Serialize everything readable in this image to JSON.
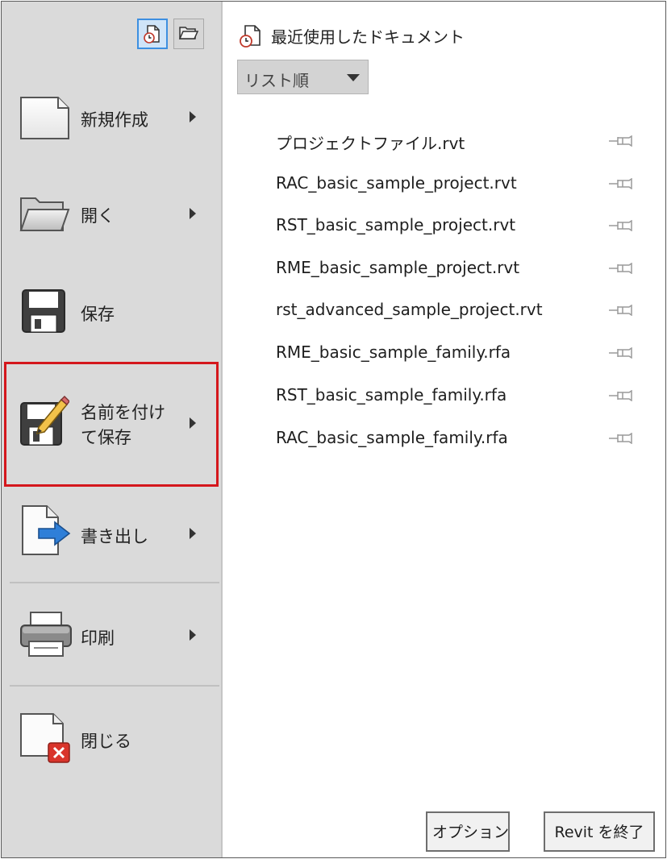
{
  "left_menu": {
    "items": [
      {
        "label": "新規作成",
        "icon": "new-document-icon",
        "has_submenu": true
      },
      {
        "label": "開く",
        "icon": "open-folder-icon",
        "has_submenu": true
      },
      {
        "label": "保存",
        "icon": "save-disk-icon",
        "has_submenu": false
      },
      {
        "label_line1": "名前を付け",
        "label_line2": "て保存",
        "icon": "save-as-icon",
        "has_submenu": true,
        "highlighted": true
      },
      {
        "label": "書き出し",
        "icon": "export-icon",
        "has_submenu": true
      },
      {
        "label": "印刷",
        "icon": "printer-icon",
        "has_submenu": true
      },
      {
        "label": "閉じる",
        "icon": "close-document-icon",
        "has_submenu": false
      }
    ],
    "view_toggles": [
      "recent-documents-icon",
      "open-documents-icon"
    ]
  },
  "recent": {
    "title": "最近使用したドキュメント",
    "sort_value": "リスト順",
    "documents": [
      "プロジェクトファイル.rvt",
      "RAC_basic_sample_project.rvt",
      "RST_basic_sample_project.rvt",
      "RME_basic_sample_project.rvt",
      "rst_advanced_sample_project.rvt",
      "RME_basic_sample_family.rfa",
      "RST_basic_sample_family.rfa",
      "RAC_basic_sample_family.rfa"
    ]
  },
  "footer": {
    "options_label": "オプション",
    "exit_label": "Revit を終了"
  },
  "colors": {
    "highlight_border": "#d4171c",
    "active_toggle": "#3d8fe0",
    "export_arrow": "#2f7fd8",
    "close_badge": "#d9342b"
  }
}
